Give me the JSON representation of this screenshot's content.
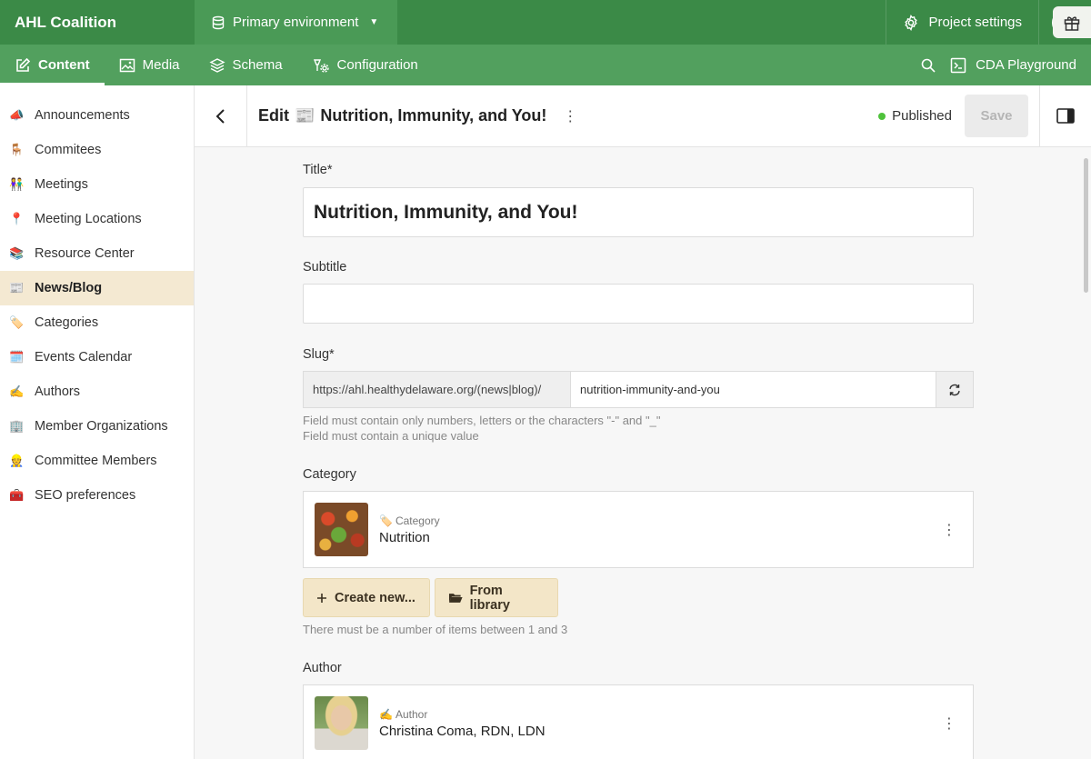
{
  "topbar": {
    "brand": "AHL Coalition",
    "environment": "Primary environment",
    "project_settings": "Project settings",
    "avatar_initial": "A"
  },
  "navbar": {
    "tabs": [
      {
        "label": "Content",
        "icon": "edit-icon",
        "active": true
      },
      {
        "label": "Media",
        "icon": "image-icon",
        "active": false
      },
      {
        "label": "Schema",
        "icon": "layers-icon",
        "active": false
      },
      {
        "label": "Configuration",
        "icon": "gears-icon",
        "active": false
      }
    ],
    "cda_playground": "CDA Playground"
  },
  "sidebar": {
    "items": [
      {
        "label": "Announcements",
        "emoji": "📣"
      },
      {
        "label": "Commitees",
        "emoji": "🪑"
      },
      {
        "label": "Meetings",
        "emoji": "👫"
      },
      {
        "label": "Meeting Locations",
        "emoji": "📍"
      },
      {
        "label": "Resource Center",
        "emoji": "📚"
      },
      {
        "label": "News/Blog",
        "emoji": "📰",
        "active": true
      },
      {
        "label": "Categories",
        "emoji": "🏷️"
      },
      {
        "label": "Events Calendar",
        "emoji": "🗓️"
      },
      {
        "label": "Authors",
        "emoji": "✍️"
      },
      {
        "label": "Member Organizations",
        "emoji": "🏢"
      },
      {
        "label": "Committee Members",
        "emoji": "👷"
      },
      {
        "label": "SEO preferences",
        "emoji": "🧰"
      }
    ]
  },
  "header": {
    "edit_prefix": "Edit",
    "title_emoji": "📰",
    "title": "Nutrition, Immunity, and You!",
    "status": "Published",
    "save_label": "Save"
  },
  "form": {
    "title_label": "Title*",
    "title_value": "Nutrition, Immunity, and You!",
    "subtitle_label": "Subtitle",
    "subtitle_value": "",
    "slug_label": "Slug*",
    "slug_prefix": "https://ahl.healthydelaware.org/(news|blog)/",
    "slug_value": "nutrition-immunity-and-you",
    "slug_hint_1": "Field must contain only numbers, letters or the characters \"-\" and \"_\"",
    "slug_hint_2": "Field must contain a unique value",
    "category_label": "Category",
    "category_card": {
      "type_emoji": "🏷️",
      "type": "Category",
      "name": "Nutrition"
    },
    "create_new": "Create new...",
    "from_library": "From library",
    "category_hint": "There must be a number of items between 1 and 3",
    "author_label": "Author",
    "author_card": {
      "type_emoji": "✍️",
      "type": "Author",
      "name": "Christina Coma, RDN, LDN"
    }
  },
  "colors": {
    "topbar": "#3b8a47",
    "navbar": "#52a05e",
    "active_sidebar": "#f4e9d2",
    "published_dot": "#4fc23b"
  }
}
